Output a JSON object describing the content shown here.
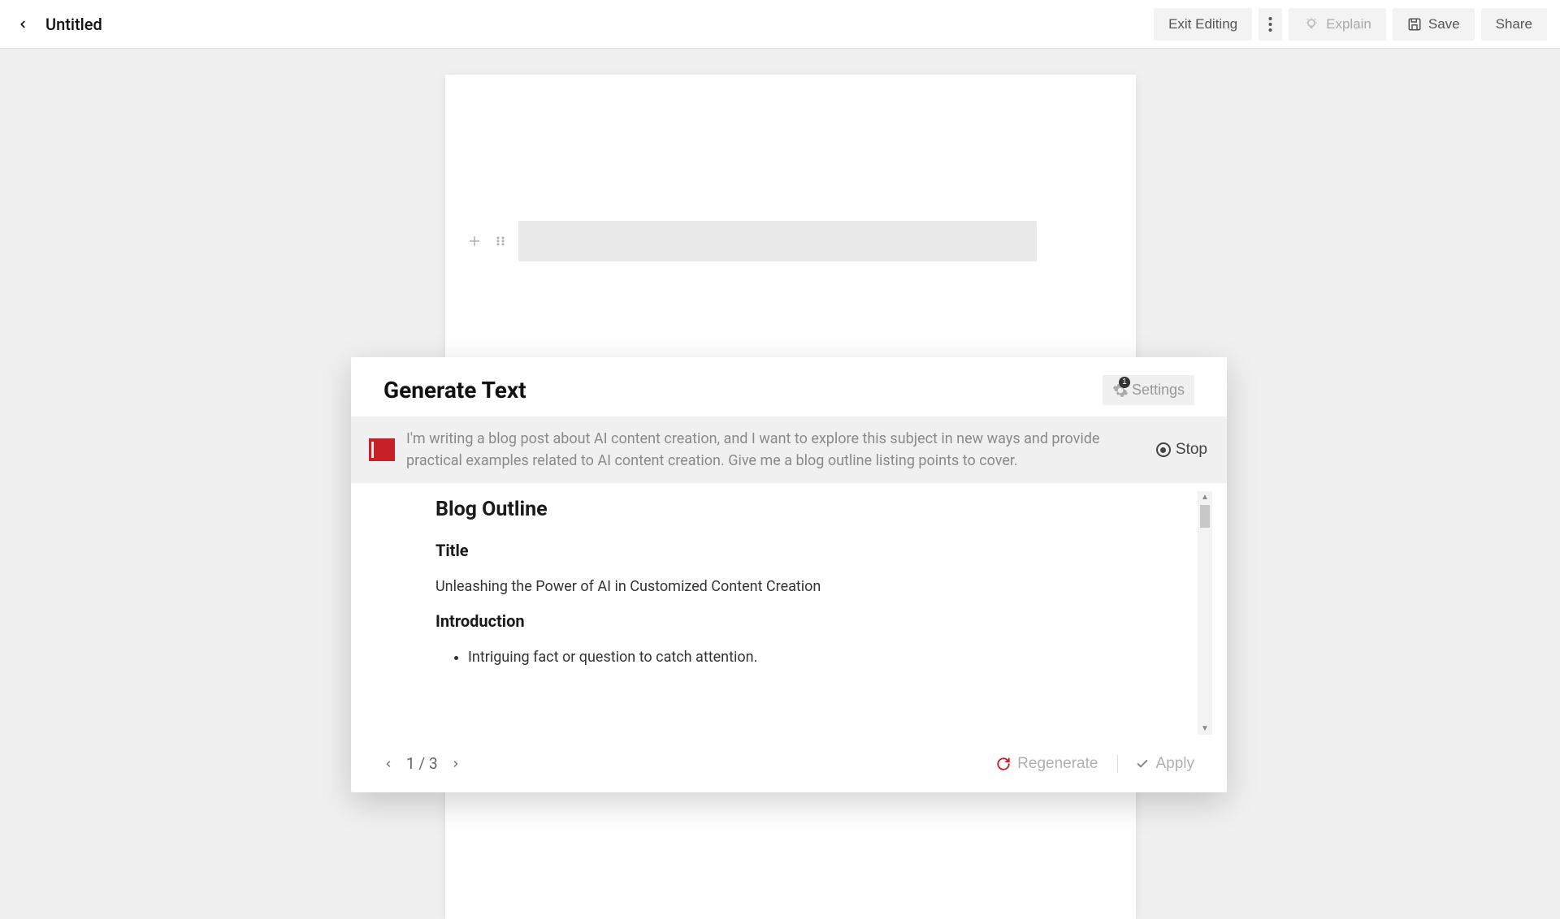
{
  "header": {
    "title": "Untitled",
    "exit_label": "Exit Editing",
    "explain_label": "Explain",
    "save_label": "Save",
    "share_label": "Share"
  },
  "panel": {
    "title": "Generate Text",
    "settings_label": "Settings",
    "settings_badge": "1",
    "prompt": "I'm writing a blog post about AI content creation, and I want to explore this subject in new ways and provide practical examples related to AI content creation. Give me a blog outline listing points to cover.",
    "stop_label": "Stop",
    "output": {
      "heading": "Blog Outline",
      "title_label": "Title",
      "title_text": "Unleashing the Power of AI in Customized Content Creation",
      "intro_label": "Introduction",
      "intro_bullet_1": "Intriguing fact or question to catch attention."
    },
    "pager": {
      "current": "1",
      "sep": "/",
      "total": "3"
    },
    "regenerate_label": "Regenerate",
    "apply_label": "Apply"
  }
}
